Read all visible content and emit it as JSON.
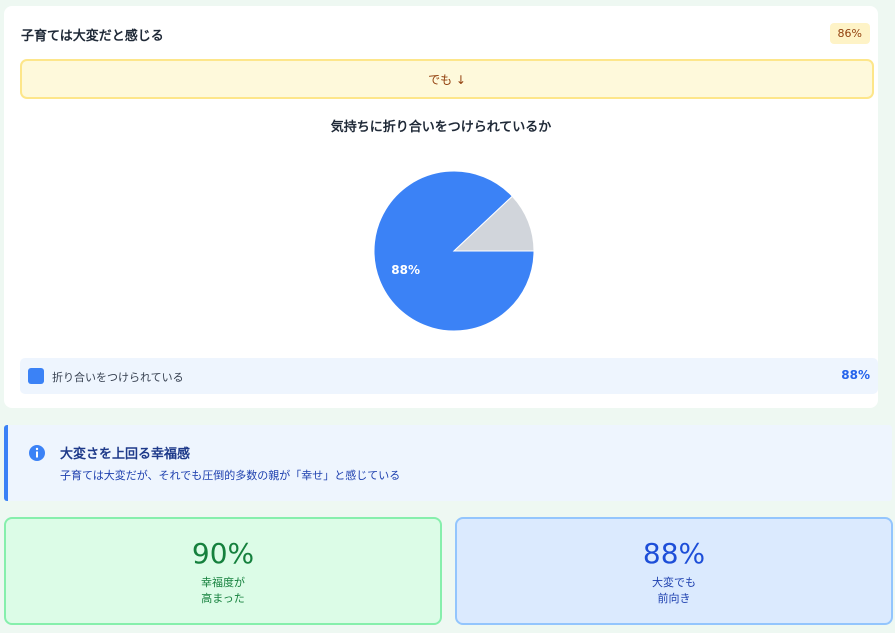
{
  "card": {
    "title": "子育ては大変だと感じる",
    "badge": "86%",
    "note": "でも ↓",
    "chart_title": "気持ちに折り合いをつけられているか",
    "legend": [
      {
        "label": "折り合いをつけられている",
        "value": "88%",
        "color": "#3b82f6"
      }
    ]
  },
  "chart_data": {
    "type": "pie",
    "slices": [
      {
        "label": "折り合いをつけられている",
        "value": 88,
        "color": "#3b82f6",
        "display": "88%"
      },
      {
        "label": "",
        "value": 12,
        "color": "#d1d5db",
        "display": ""
      }
    ]
  },
  "info": {
    "icon": "info-icon",
    "title": "大変さを上回る幸福感",
    "text": "子育ては大変だが、それでも圧倒的多数の親が「幸せ」と感じている"
  },
  "stats": [
    {
      "value": "90%",
      "label_line1": "幸福度が",
      "label_line2": "高まった",
      "color": "#15803d"
    },
    {
      "value": "88%",
      "label_line1": "大変でも",
      "label_line2": "前向き",
      "color": "#1d4ed8"
    }
  ]
}
